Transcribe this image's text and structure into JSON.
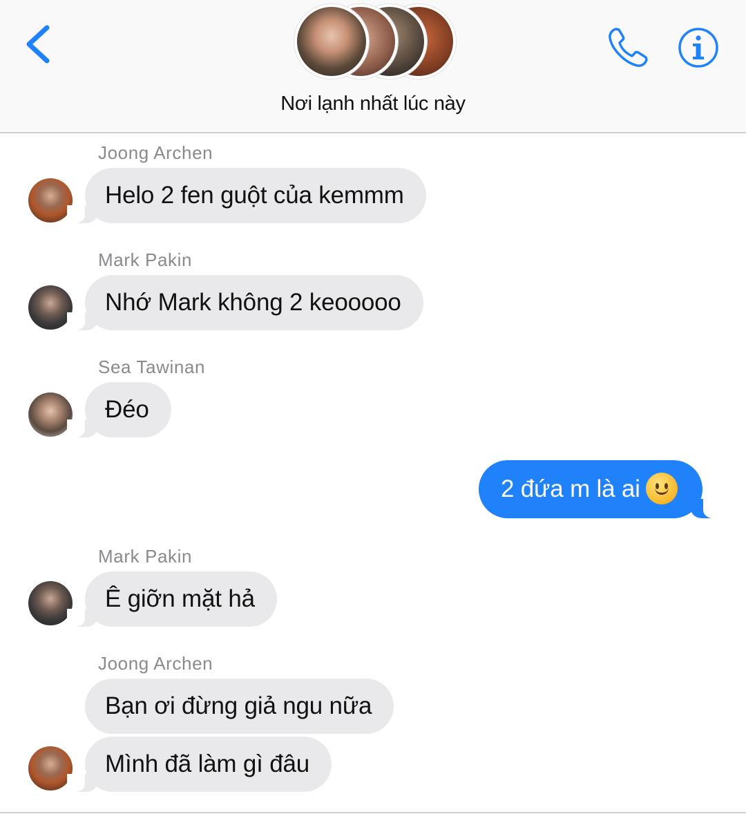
{
  "header": {
    "title": "Nơi lạnh nhất lúc này",
    "back_icon": "chevron-left-icon",
    "call_icon": "phone-icon",
    "info_icon": "info-icon",
    "accent": "#1f82fb"
  },
  "messages": [
    {
      "sender": "Joong Archen",
      "text": "Helo 2 fen guột của kemmm"
    },
    {
      "sender": "Mark Pakin",
      "text": "Nhớ Mark không 2 keooooo"
    },
    {
      "sender": "Sea Tawinan",
      "text": "Đéo"
    },
    {
      "text": "2 đứa m là ai",
      "emoji": "slightly-smiling-face-icon",
      "outgoing": true
    },
    {
      "sender": "Mark Pakin",
      "text": "Ê giỡn mặt hả"
    },
    {
      "sender": "Joong Archen",
      "text": "Bạn ơi đừng giả ngu nữa"
    },
    {
      "text": "Mình đã làm gì đâu"
    }
  ],
  "colors": {
    "incoming_bubble": "#e9e9eb",
    "outgoing_bubble": "#1f82fb",
    "sender_name": "#8a8a8e"
  }
}
